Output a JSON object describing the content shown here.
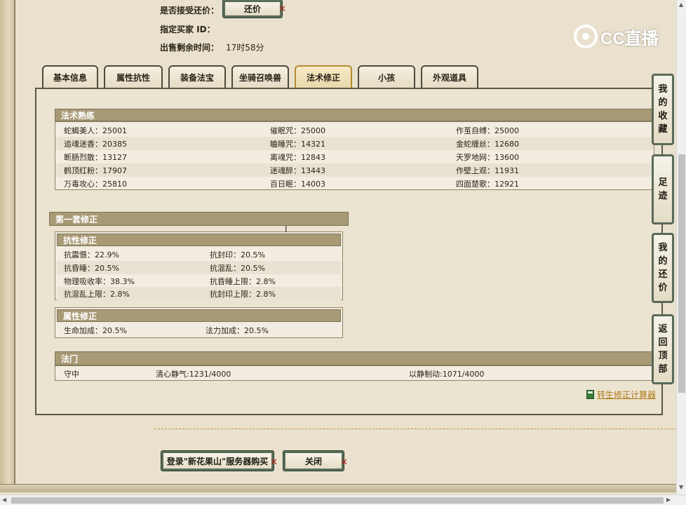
{
  "top_info": {
    "accept_bargain_label": "是否接受还价：",
    "bargain_button": "还价",
    "buyer_id_label": "指定买家 ID：",
    "remaining_time_label": "出售剩余时间：",
    "remaining_time_value": "17时58分"
  },
  "logo": {
    "text": "CC直播"
  },
  "tabs": [
    {
      "label": "基本信息",
      "active": false
    },
    {
      "label": "属性抗性",
      "active": false
    },
    {
      "label": "装备法宝",
      "active": false
    },
    {
      "label": "坐骑召唤兽",
      "active": false
    },
    {
      "label": "法术修正",
      "active": true
    },
    {
      "label": "小孩",
      "active": false
    },
    {
      "label": "外观道具",
      "active": false
    }
  ],
  "spell_mastery": {
    "title": "法术熟练",
    "rows": [
      [
        "蛇蝎美人：25001",
        "催眠咒：25000",
        "作茧自缚：25000"
      ],
      [
        "追魂迷香：20385",
        "瞌睡咒：14321",
        "金蛇缠丝：12680"
      ],
      [
        "断肠烈散：13127",
        "离魂咒：12843",
        "天罗地网：13600"
      ],
      [
        "鹤顶红粉：17907",
        "迷魂醉：13443",
        "作壁上观：11931"
      ],
      [
        "万毒攻心：25810",
        "百日眠：14003",
        "四面楚歌：12921"
      ]
    ]
  },
  "first_set": {
    "title": "第一套修正",
    "resistance": {
      "title": "抗性修正",
      "rows": [
        [
          "抗震慑：22.9%",
          "抗封印：20.5%"
        ],
        [
          "抗昏睡：20.5%",
          "抗混乱：20.5%"
        ],
        [
          "物理吸收率：38.3%",
          "抗昏睡上限：2.8%"
        ],
        [
          "抗混乱上限：2.8%",
          "抗封印上限：2.8%"
        ]
      ]
    },
    "attribute": {
      "title": "属性修正",
      "rows": [
        [
          "生命加成：20.5%",
          "法力加成：20.5%"
        ]
      ]
    }
  },
  "school": {
    "title": "法门",
    "row": [
      "守中",
      "清心静气:1231/4000",
      "以静制动:1071/4000"
    ]
  },
  "calculator_link": "转生修正计算器",
  "bottom_buttons": {
    "login_buy": "登录\"新花果山\"服务器购买",
    "close": "关闭"
  },
  "sidebar": {
    "favorites": [
      "我",
      "的",
      "收",
      "藏"
    ],
    "footprints": [
      "足",
      "迹"
    ],
    "my_bargain": [
      "我",
      "的",
      "还",
      "价"
    ],
    "back_top": [
      "返",
      "回",
      "顶",
      "部"
    ]
  },
  "colors": {
    "section_header": "#a89a75",
    "panel_bg": "#ebe4d1",
    "active_tab_border": "#b38a2e",
    "link": "#b07a1c"
  }
}
